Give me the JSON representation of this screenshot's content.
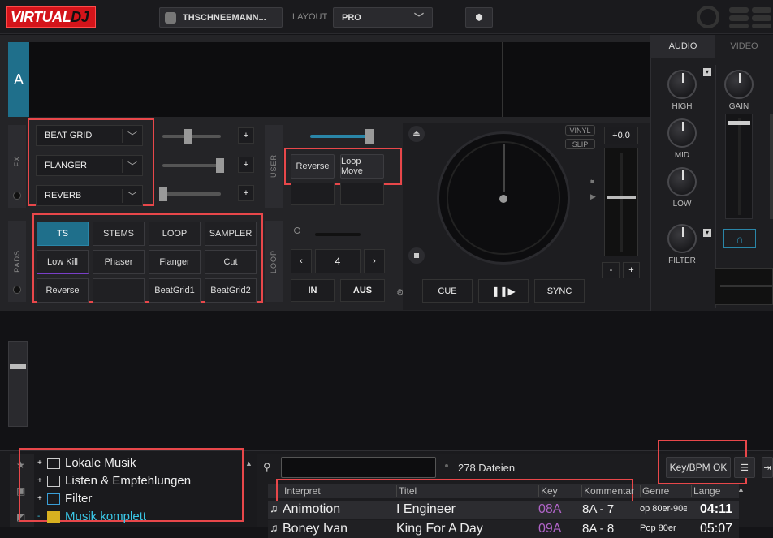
{
  "app": {
    "logo_main": "VIRTUAL",
    "logo_dj": "DJ"
  },
  "topbar": {
    "user": "THSCHNEEMANN...",
    "layout_label": "LAYOUT",
    "layout_value": "PRO"
  },
  "mixer": {
    "tab_audio": "AUDIO",
    "tab_video": "VIDEO",
    "high": "HIGH",
    "mid": "MID",
    "low": "LOW",
    "filter": "FILTER",
    "gain": "GAIN"
  },
  "deck": {
    "letter": "A",
    "fx_label": "FX",
    "user_label": "USER",
    "pads_label": "PADS",
    "loop_label": "LOOP",
    "fx": [
      "BEAT GRID",
      "FLANGER",
      "REVERB"
    ],
    "user_buttons": [
      "Reverse",
      "Loop Move"
    ],
    "pad_modes": [
      "TS",
      "STEMS",
      "LOOP",
      "SAMPLER"
    ],
    "pads_row1": [
      "Low Kill",
      "Phaser",
      "Flanger",
      "Cut"
    ],
    "pads_row2": [
      "Reverse",
      "",
      "BeatGrid1",
      "BeatGrid2"
    ],
    "loop_size": "4",
    "loop_in": "IN",
    "loop_out": "AUS",
    "vinyl": "VINYL",
    "slip": "SLIP",
    "pitch": "+0.0",
    "cue": "CUE",
    "sync": "SYNC",
    "pitch_minus": "-",
    "pitch_plus": "+",
    "fx_plus": "+"
  },
  "browser": {
    "folders": [
      "Lokale Musik",
      "Listen & Empfehlungen",
      "Filter",
      "Musik komplett"
    ],
    "file_count": "278 Dateien",
    "key_bpm": "Key/BPM OK",
    "columns": [
      "Interpret",
      "Titel",
      "Key",
      "Kommentar",
      "Genre",
      "Lange"
    ],
    "rows": [
      {
        "artist": "Animotion",
        "title": "I Engineer",
        "key": "08A",
        "comment": "8A - 7",
        "genre": "op 80er-90e",
        "length": "04:11"
      },
      {
        "artist": "Boney Ivan",
        "title": "King For A Day",
        "key": "09A",
        "comment": "8A - 8",
        "genre": "Pop 80er",
        "length": "05:07"
      }
    ]
  },
  "colors": {
    "accent": "#1f6f8b",
    "highlight": "#e8474a",
    "key": "#b064c8"
  }
}
